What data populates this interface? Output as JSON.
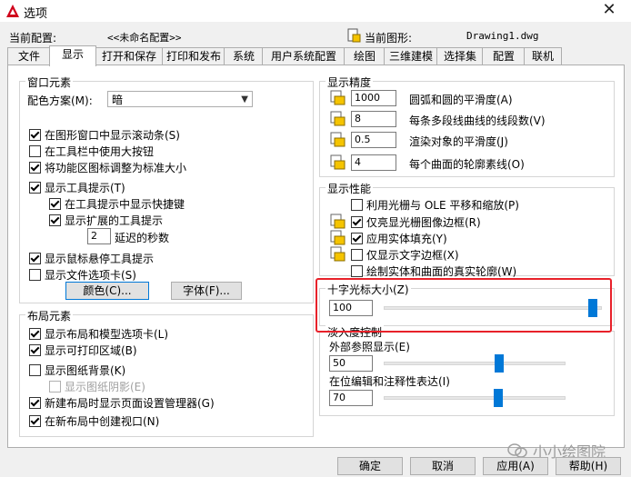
{
  "window": {
    "title": "选项",
    "close_glyph": "✕",
    "icon": "autocad-logo-icon"
  },
  "header": {
    "current_profile_label": "当前配置:",
    "current_profile_value": "<<未命名配置>>",
    "current_drawing_label": "当前图形:",
    "current_drawing_value": "Drawing1.dwg"
  },
  "tabs": [
    "文件",
    "显示",
    "打开和保存",
    "打印和发布",
    "系统",
    "用户系统配置",
    "绘图",
    "三维建模",
    "选择集",
    "配置",
    "联机"
  ],
  "active_tab": "显示",
  "window_elements": {
    "title": "窗口元素",
    "color_scheme_label": "配色方案(M):",
    "color_scheme_value": "暗",
    "options": [
      {
        "label": "在图形窗口中显示滚动条(S)",
        "checked": true
      },
      {
        "label": "在工具栏中使用大按钮",
        "checked": false
      },
      {
        "label": "将功能区图标调整为标准大小",
        "checked": true
      },
      {
        "label": "显示工具提示(T)",
        "checked": true
      },
      {
        "label": "在工具提示中显示快捷键",
        "checked": true
      },
      {
        "label": "显示扩展的工具提示",
        "checked": true
      },
      {
        "label": "显示鼠标悬停工具提示",
        "checked": true
      },
      {
        "label": "显示文件选项卡(S)",
        "checked": false
      }
    ],
    "delay_value": "2",
    "delay_label": "延迟的秒数",
    "colors_button": "颜色(C)...",
    "fonts_button": "字体(F)..."
  },
  "layout_elements": {
    "title": "布局元素",
    "options": [
      {
        "label": "显示布局和模型选项卡(L)",
        "checked": true
      },
      {
        "label": "显示可打印区域(B)",
        "checked": true
      },
      {
        "label": "显示图纸背景(K)",
        "checked": false
      },
      {
        "label": "显示图纸阴影(E)",
        "checked": false,
        "disabled": true
      },
      {
        "label": "新建布局时显示页面设置管理器(G)",
        "checked": true
      },
      {
        "label": "在新布局中创建视口(N)",
        "checked": true
      }
    ]
  },
  "display_resolution": {
    "title": "显示精度",
    "rows": [
      {
        "value": "1000",
        "label": "圆弧和圆的平滑度(A)"
      },
      {
        "value": "8",
        "label": "每条多段线曲线的线段数(V)"
      },
      {
        "value": "0.5",
        "label": "渲染对象的平滑度(J)"
      },
      {
        "value": "4",
        "label": "每个曲面的轮廓素线(O)"
      }
    ]
  },
  "display_performance": {
    "title": "显示性能",
    "options": [
      {
        "label": "利用光栅与 OLE 平移和缩放(P)",
        "checked": false
      },
      {
        "label": "仅亮显光栅图像边框(R)",
        "checked": true
      },
      {
        "label": "应用实体填充(Y)",
        "checked": true
      },
      {
        "label": "仅显示文字边框(X)",
        "checked": false
      },
      {
        "label": "绘制实体和曲面的真实轮廓(W)",
        "checked": false
      }
    ]
  },
  "crosshair": {
    "title": "十字光标大小(Z)",
    "value": "100",
    "level": 100
  },
  "fade_control": {
    "title": "淡入度控制",
    "xref_label": "外部参照显示(E)",
    "xref_value": "50",
    "xref_level": 50,
    "inplace_label": "在位编辑和注释性表达(I)",
    "inplace_value": "70",
    "inplace_level": 70
  },
  "footer": {
    "ok": "确定",
    "cancel": "取消",
    "apply": "应用(A)",
    "help": "帮助(H)",
    "watermark": "小小绘图院"
  },
  "colors": {
    "accent": "#0078d7",
    "highlight_red": "#e8212a"
  }
}
